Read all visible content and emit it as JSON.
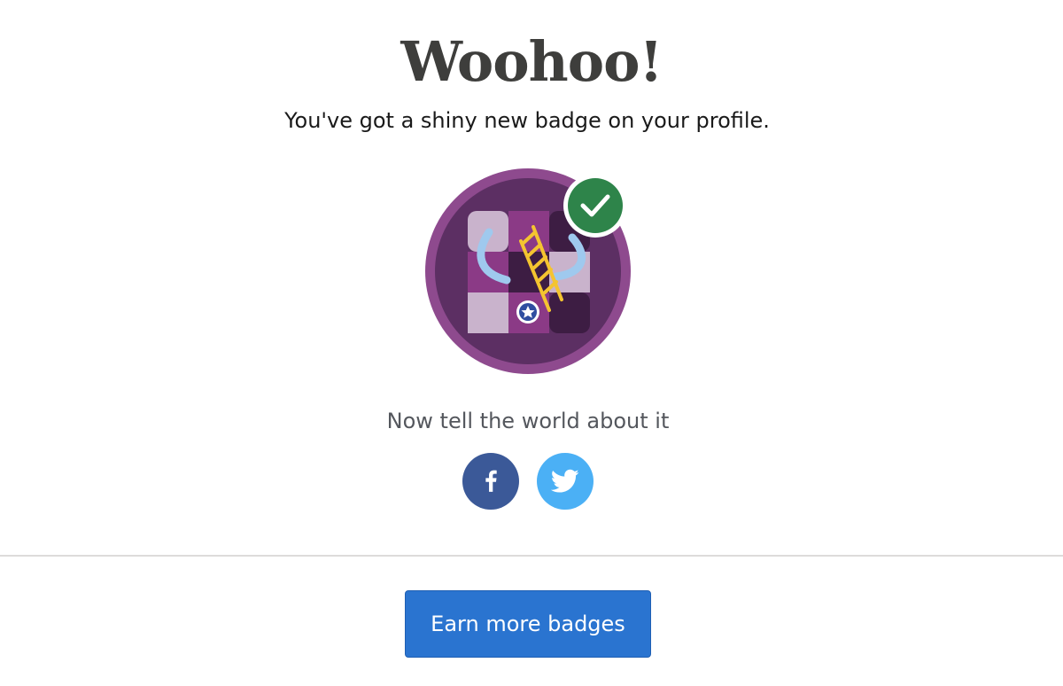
{
  "header": {
    "title": "Woohoo!",
    "subtitle": "You've got a shiny new badge on your profile."
  },
  "badge": {
    "icon": "ladder-game-badge-icon",
    "status_icon": "check-icon",
    "status_color": "#2e844a",
    "ring_color": "#8e4a8e"
  },
  "share": {
    "prompt": "Now tell the world about it",
    "buttons": [
      {
        "icon": "facebook-icon",
        "color": "#3b5998"
      },
      {
        "icon": "twitter-icon",
        "color": "#4bb0f5"
      }
    ]
  },
  "footer": {
    "earn_label": "Earn more badges",
    "accent": "#2a74d0"
  }
}
